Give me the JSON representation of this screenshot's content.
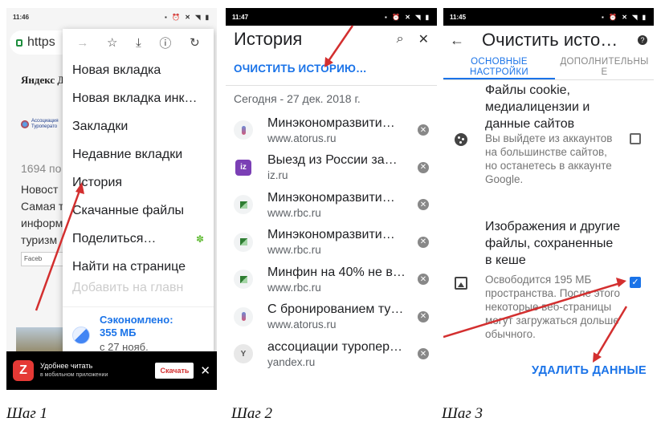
{
  "captions": [
    "Шаг 1",
    "Шаг 2",
    "Шаг 3"
  ],
  "step1": {
    "time": "11:46",
    "url_fragment": "https",
    "bg": {
      "yandex": "Яндекс Дз",
      "assoc": "Ассоциация Туроперато",
      "count": "1694 по",
      "news": [
        "Новост",
        "Самая т",
        "информ",
        "туризм"
      ],
      "facebook": "Faceb"
    },
    "menu_icons": [
      "arrow-forward-icon",
      "star-icon",
      "download-icon",
      "info-icon",
      "refresh-icon"
    ],
    "menu_items": [
      "Новая вкладка",
      "Новая вкладка инк…",
      "Закладки",
      "Недавние вкладки",
      "История",
      "Скачанные файлы",
      "Поделиться…",
      "Найти на странице"
    ],
    "menu_faded": "Добавить на главн",
    "saved_title": "Сэкономлено: 355 МБ",
    "saved_sub": "с 27 нояб.",
    "banner": {
      "logo": "Z",
      "line1": "Удобнее читать",
      "line2": "в мобильном приложении",
      "button": "Скачать",
      "close": "✕"
    }
  },
  "step2": {
    "time": "11:47",
    "title": "История",
    "clear_label": "ОЧИСТИТЬ ИСТОРИЮ…",
    "date": "Сегодня - 27 дек. 2018 г.",
    "items": [
      {
        "title": "Минэкономразвити…",
        "url": "www.atorus.ru",
        "icon": "atorus"
      },
      {
        "title": "Выезд из России за…",
        "url": "iz.ru",
        "icon": "iz"
      },
      {
        "title": "Минэкономразвити…",
        "url": "www.rbc.ru",
        "icon": "rbc"
      },
      {
        "title": "Минэкономразвити…",
        "url": "www.rbc.ru",
        "icon": "rbc"
      },
      {
        "title": "Минфин на 40% не в…",
        "url": "www.rbc.ru",
        "icon": "rbc"
      },
      {
        "title": "С бронированием ту…",
        "url": "www.atorus.ru",
        "icon": "atorus"
      },
      {
        "title": "ассоциации туропер…",
        "url": "yandex.ru",
        "icon": "yandex"
      }
    ],
    "iz_label": "iz",
    "yandex_label": "Y"
  },
  "step3": {
    "time": "11:45",
    "title": "Очистить исто…",
    "tabs": [
      "ОСНОВНЫЕ НАСТРОЙКИ",
      "ДОПОЛНИТЕЛЬНЫ Е"
    ],
    "cookie_title": "Файлы cookie, медиалицензии и данные сайтов",
    "cookie_desc": "Вы выйдете из аккаунтов на большинстве сайтов, но останетесь в аккаунте Google.",
    "cache_title": "Изображения и другие файлы, сохраненные в кеше",
    "cache_desc": "Освободится 195 МБ пространства. После этого некоторые веб-страницы могут загружаться дольше обычного.",
    "cookie_checked": false,
    "cache_checked": true,
    "delete_label": "УДАЛИТЬ ДАННЫЕ"
  },
  "colors": {
    "accent": "#1a73e8",
    "arrow": "#d32f2f"
  }
}
